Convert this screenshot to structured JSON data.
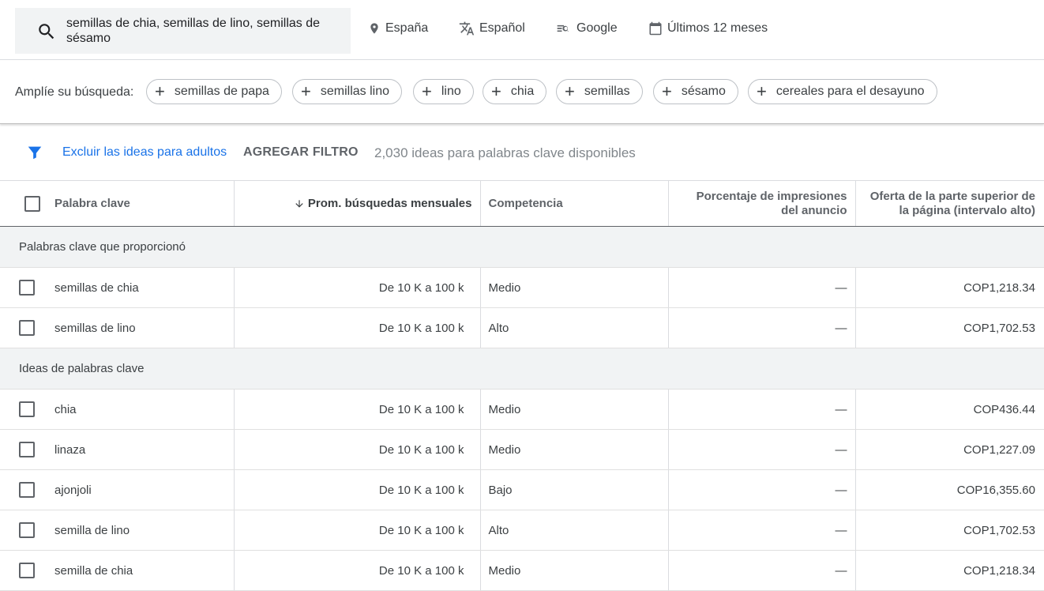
{
  "search": {
    "query": "semillas de chia, semillas de lino, semillas de sésamo"
  },
  "toolbar": {
    "location": "España",
    "language": "Español",
    "network": "Google",
    "date_range": "Últimos 12 meses"
  },
  "broaden": {
    "label": "Amplíe su búsqueda:",
    "chips": [
      "semillas de papa",
      "semillas lino",
      "lino",
      "chia",
      "semillas",
      "sésamo",
      "cereales para el desayuno"
    ]
  },
  "filters": {
    "adult_filter": "Excluir las ideas para adultos",
    "add_filter": "AGREGAR FILTRO",
    "ideas_count": "2,030 ideas para palabras clave disponibles"
  },
  "table": {
    "headers": {
      "keyword": "Palabra clave",
      "avg_searches": "Prom. búsquedas mensuales",
      "competition": "Competencia",
      "impression_share": "Porcentaje de impresiones del anuncio",
      "top_bid_high": "Oferta de la parte superior de la página (intervalo alto)"
    },
    "groups": [
      {
        "title": "Palabras clave que proporcionó",
        "rows": [
          {
            "keyword": "semillas de chia",
            "avg": "De 10 K a 100 k",
            "competition": "Medio",
            "impression": "—",
            "bid": "COP1,218.34"
          },
          {
            "keyword": "semillas de lino",
            "avg": "De 10 K a 100 k",
            "competition": "Alto",
            "impression": "—",
            "bid": "COP1,702.53"
          }
        ]
      },
      {
        "title": "Ideas de palabras clave",
        "rows": [
          {
            "keyword": "chia",
            "avg": "De 10 K a 100 k",
            "competition": "Medio",
            "impression": "—",
            "bid": "COP436.44"
          },
          {
            "keyword": "linaza",
            "avg": "De 10 K a 100 k",
            "competition": "Medio",
            "impression": "—",
            "bid": "COP1,227.09"
          },
          {
            "keyword": "ajonjoli",
            "avg": "De 10 K a 100 k",
            "competition": "Bajo",
            "impression": "—",
            "bid": "COP16,355.60"
          },
          {
            "keyword": "semilla de lino",
            "avg": "De 10 K a 100 k",
            "competition": "Alto",
            "impression": "—",
            "bid": "COP1,702.53"
          },
          {
            "keyword": "semilla de chia",
            "avg": "De 10 K a 100 k",
            "competition": "Medio",
            "impression": "—",
            "bid": "COP1,218.34"
          }
        ]
      }
    ]
  },
  "colors": {
    "accent": "#1a73e8",
    "text": "#3c4043",
    "group_bg": "#f1f3f4"
  }
}
